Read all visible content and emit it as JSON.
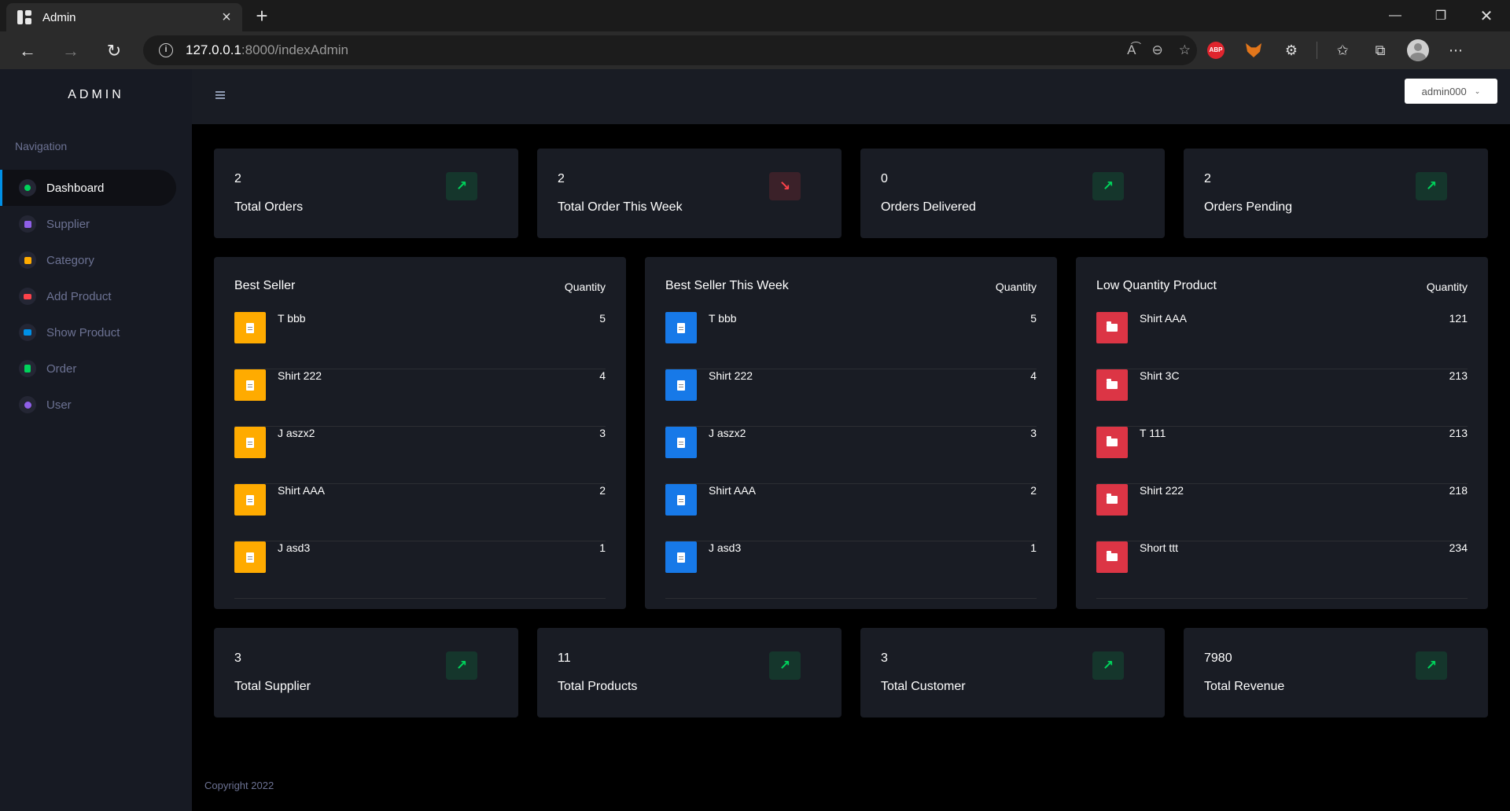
{
  "browser": {
    "tab_title": "Admin",
    "url_host": "127.0.0.1",
    "url_path": ":8000/indexAdmin",
    "abp_label": "ABP"
  },
  "sidebar": {
    "brand": "ADMIN",
    "heading": "Navigation",
    "items": [
      {
        "label": "Dashboard",
        "color": "#00d25b"
      },
      {
        "label": "Supplier",
        "color": "#8f5fe8"
      },
      {
        "label": "Category",
        "color": "#ffab00"
      },
      {
        "label": "Add Product",
        "color": "#fc424a"
      },
      {
        "label": "Show Product",
        "color": "#0090e7"
      },
      {
        "label": "Order",
        "color": "#00d25b"
      },
      {
        "label": "User",
        "color": "#8f5fe8"
      }
    ]
  },
  "topnav": {
    "user": "admin000"
  },
  "stats_top": [
    {
      "value": "2",
      "label": "Total Orders",
      "trend": "up"
    },
    {
      "value": "2",
      "label": "Total Order This Week",
      "trend": "down"
    },
    {
      "value": "0",
      "label": "Orders Delivered",
      "trend": "up"
    },
    {
      "value": "2",
      "label": "Orders Pending",
      "trend": "up"
    }
  ],
  "lists": [
    {
      "title": "Best Seller",
      "qty_header": "Quantity",
      "icon_color": "yellow",
      "rows": [
        {
          "name": "T bbb",
          "qty": "5"
        },
        {
          "name": "Shirt 222",
          "qty": "4"
        },
        {
          "name": "J aszx2",
          "qty": "3"
        },
        {
          "name": "Shirt AAA",
          "qty": "2"
        },
        {
          "name": "J asd3",
          "qty": "1"
        }
      ]
    },
    {
      "title": "Best Seller This Week",
      "qty_header": "Quantity",
      "icon_color": "blue",
      "rows": [
        {
          "name": "T bbb",
          "qty": "5"
        },
        {
          "name": "Shirt 222",
          "qty": "4"
        },
        {
          "name": "J aszx2",
          "qty": "3"
        },
        {
          "name": "Shirt AAA",
          "qty": "2"
        },
        {
          "name": "J asd3",
          "qty": "1"
        }
      ]
    },
    {
      "title": "Low Quantity Product",
      "qty_header": "Quantity",
      "icon_color": "red",
      "rows": [
        {
          "name": "Shirt AAA",
          "qty": "121"
        },
        {
          "name": "Shirt 3C",
          "qty": "213"
        },
        {
          "name": "T 111",
          "qty": "213"
        },
        {
          "name": "Shirt 222",
          "qty": "218"
        },
        {
          "name": "Short ttt",
          "qty": "234"
        }
      ]
    }
  ],
  "stats_bottom": [
    {
      "value": "3",
      "label": "Total Supplier",
      "trend": "up"
    },
    {
      "value": "11",
      "label": "Total Products",
      "trend": "up"
    },
    {
      "value": "3",
      "label": "Total Customer",
      "trend": "up"
    },
    {
      "value": "7980",
      "label": "Total Revenue",
      "trend": "up"
    }
  ],
  "footer": "Copyright 2022",
  "colors": {
    "success": "#00d25b",
    "danger": "#fc424a",
    "card_bg": "#191c24",
    "sidebar_bg": "#171a23"
  }
}
